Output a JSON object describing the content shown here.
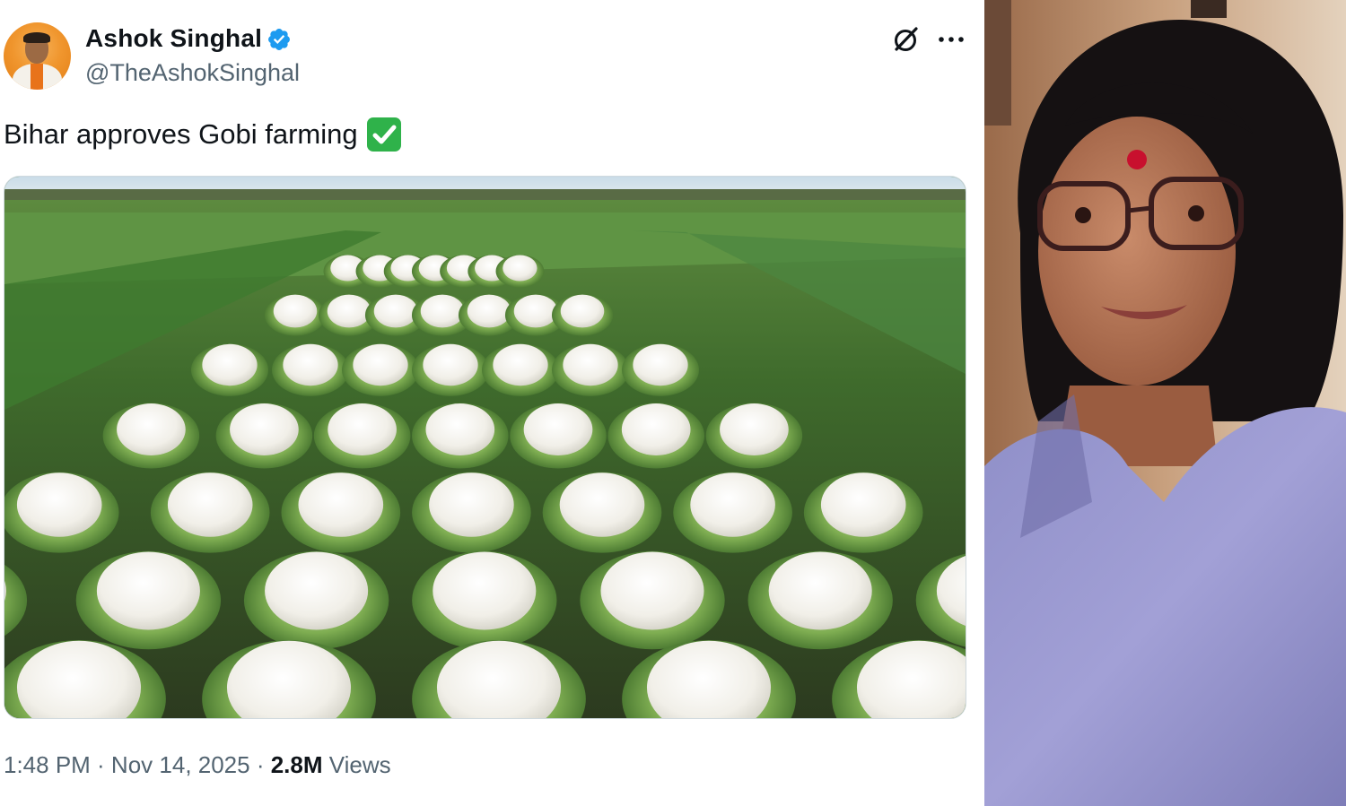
{
  "tweet": {
    "author_name": "Ashok Singhal",
    "author_handle": "@TheAshokSinghal",
    "verified": true,
    "text": "Bihar approves Gobi farming",
    "text_emoji": "✅",
    "timestamp": "1:48 PM · Nov 14, 2025 · ",
    "views_count": "2.8M",
    "views_label": " Views",
    "media_description": "field of cauliflower plants in rows",
    "icons": [
      "verified-badge-icon",
      "grok-icon",
      "more-icon",
      "check-mark-emoji"
    ]
  },
  "side_photo": {
    "description": "portrait of a woman with glasses, bindi and lavender scarf"
  },
  "colors": {
    "verified_blue": "#1d9bf0",
    "secondary_text": "#536471",
    "primary_text": "#0f1419",
    "emoji_green": "#2fb24a"
  }
}
